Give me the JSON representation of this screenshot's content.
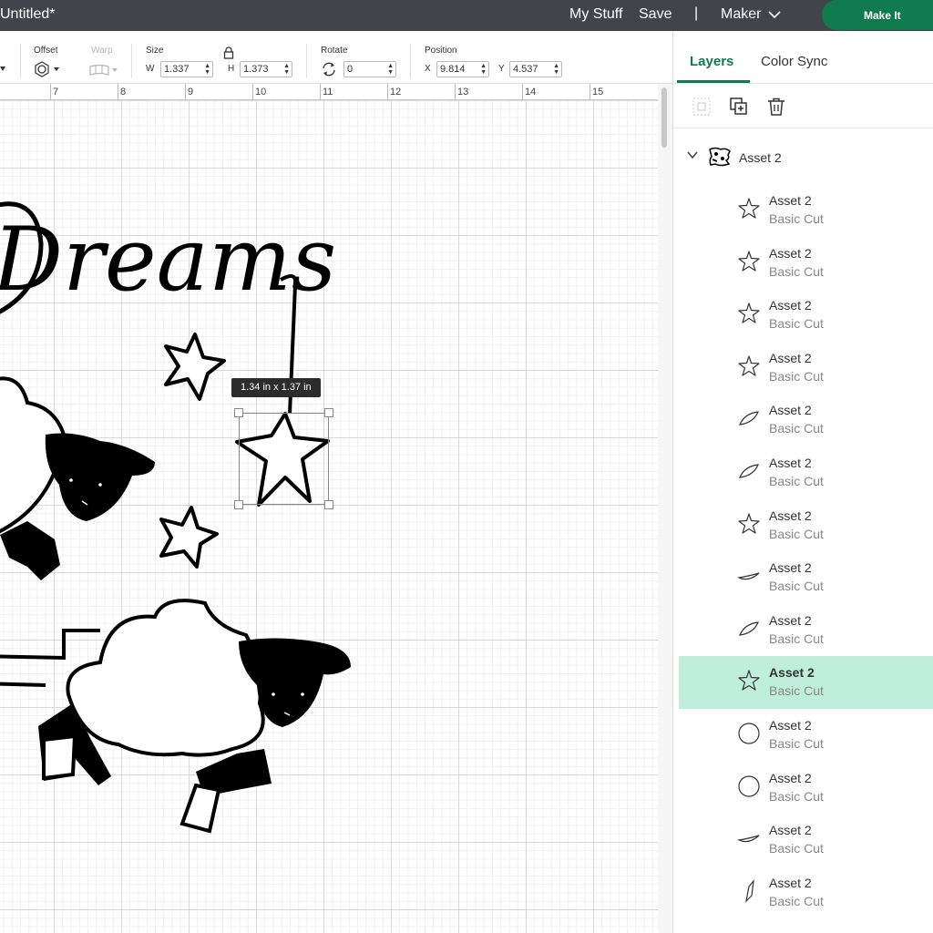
{
  "header": {
    "title": "Untitled*",
    "my_stuff": "My Stuff",
    "save": "Save",
    "separator": "|",
    "machine": "Maker",
    "make_it": "Make It"
  },
  "toolbar": {
    "offset_label": "Offset",
    "warp_label": "Warp",
    "size_label": "Size",
    "w_label": "W",
    "width_value": "1.337",
    "h_label": "H",
    "height_value": "1.373",
    "rotate_label": "Rotate",
    "rotate_value": "0",
    "position_label": "Position",
    "x_label": "X",
    "x_value": "9.814",
    "y_label": "Y",
    "y_value": "4.537"
  },
  "ruler": {
    "ticks": [
      "7",
      "8",
      "9",
      "10",
      "11",
      "12",
      "13",
      "14",
      "15"
    ]
  },
  "canvas": {
    "dimension_tooltip": "1.34  in x 1.37  in",
    "design_text": "Dreams"
  },
  "panel": {
    "tabs": [
      {
        "label": "Layers",
        "active": true
      },
      {
        "label": "Color Sync",
        "active": false
      }
    ],
    "group_name": "Asset 2",
    "layers": [
      {
        "name": "Asset 2",
        "type": "Basic Cut",
        "shape": "star"
      },
      {
        "name": "Asset 2",
        "type": "Basic Cut",
        "shape": "star"
      },
      {
        "name": "Asset 2",
        "type": "Basic Cut",
        "shape": "star"
      },
      {
        "name": "Asset 2",
        "type": "Basic Cut",
        "shape": "star"
      },
      {
        "name": "Asset 2",
        "type": "Basic Cut",
        "shape": "leaf"
      },
      {
        "name": "Asset 2",
        "type": "Basic Cut",
        "shape": "leaf"
      },
      {
        "name": "Asset 2",
        "type": "Basic Cut",
        "shape": "star"
      },
      {
        "name": "Asset 2",
        "type": "Basic Cut",
        "shape": "crescent"
      },
      {
        "name": "Asset 2",
        "type": "Basic Cut",
        "shape": "leaf"
      },
      {
        "name": "Asset 2",
        "type": "Basic Cut",
        "shape": "star",
        "selected": true
      },
      {
        "name": "Asset 2",
        "type": "Basic Cut",
        "shape": "circle"
      },
      {
        "name": "Asset 2",
        "type": "Basic Cut",
        "shape": "circle"
      },
      {
        "name": "Asset 2",
        "type": "Basic Cut",
        "shape": "crescent"
      },
      {
        "name": "Asset 2",
        "type": "Basic Cut",
        "shape": "sliver"
      }
    ]
  },
  "colors": {
    "header_bg": "#414549",
    "accent_green": "#0f7a4c",
    "selected_row": "#bfeedd"
  }
}
